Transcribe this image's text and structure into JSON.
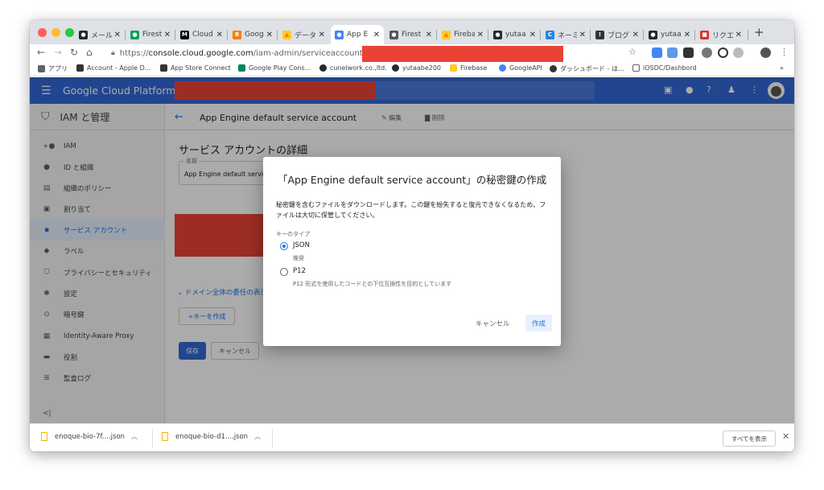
{
  "browser": {
    "tabs": [
      {
        "title": "メール",
        "favicon": "github-icon",
        "color": "#24292e",
        "glyph": "●"
      },
      {
        "title": "Firest",
        "favicon": "hangouts-icon",
        "color": "#0f9d58",
        "glyph": "●"
      },
      {
        "title": "Cloud",
        "favicon": "medium-icon",
        "color": "#000000",
        "glyph": "M"
      },
      {
        "title": "Google",
        "favicon": "blogger-icon",
        "color": "#f57d00",
        "glyph": "B"
      },
      {
        "title": "データ",
        "favicon": "firebase-icon",
        "color": "#ffca28",
        "glyph": "▲"
      },
      {
        "title": "App E",
        "favicon": "gcp-shield-icon",
        "color": "#4285f4",
        "glyph": "●"
      },
      {
        "title": "Firest",
        "favicon": "avatar-icon",
        "color": "#555555",
        "glyph": "●"
      },
      {
        "title": "Fireba",
        "favicon": "firebase-icon",
        "color": "#ffca28",
        "glyph": "▲"
      },
      {
        "title": "yutaa",
        "favicon": "github-icon",
        "color": "#24292e",
        "glyph": "●"
      },
      {
        "title": "ネーミ",
        "favicon": "cc-icon",
        "color": "#1e88e5",
        "glyph": "C"
      },
      {
        "title": "ブログ",
        "favicon": "info-icon",
        "color": "#333333",
        "glyph": "!"
      },
      {
        "title": "yutaa",
        "favicon": "github-icon",
        "color": "#24292e",
        "glyph": "●"
      },
      {
        "title": "リクエ",
        "favicon": "red-square-icon",
        "color": "#d93025",
        "glyph": "■"
      }
    ],
    "new_tab_label": "+",
    "url_prefix": "https://",
    "url_host": "console.cloud.google.com",
    "url_path": "/iam-admin/serviceaccounts/details/",
    "bookmarks": [
      {
        "label": "アプリ",
        "icon": "apps-grid-icon",
        "color": "#5f6368"
      },
      {
        "label": "Account - Apple D...",
        "icon": "apple-icon",
        "color": "#333333"
      },
      {
        "label": "App Store Connect",
        "icon": "apple-icon",
        "color": "#333333"
      },
      {
        "label": "Google Play Cons...",
        "icon": "google-play-icon",
        "color": "#01875f"
      },
      {
        "label": "cunelwork.co.,ltd.",
        "icon": "github-icon",
        "color": "#24292e"
      },
      {
        "label": "yutaabe200",
        "icon": "github-icon",
        "color": "#24292e"
      },
      {
        "label": "Firebase",
        "icon": "firebase-icon",
        "color": "#ffca28"
      },
      {
        "label": "GoogleAPI",
        "icon": "google-icon",
        "color": "#4285f4"
      },
      {
        "label": "ダッシュボード - は...",
        "icon": "info-icon",
        "color": "#333333"
      },
      {
        "label": "iOSDC/Dashbord",
        "icon": "doc-icon",
        "color": "#5f6368"
      }
    ],
    "bookmarks_more": "»"
  },
  "gcp": {
    "title": "Google Cloud Platform"
  },
  "sidebar": {
    "header": "IAM と管理",
    "items": [
      {
        "label": "IAM",
        "icon": "person-add-icon"
      },
      {
        "label": "ID と組織",
        "icon": "account-circle-icon"
      },
      {
        "label": "組織のポリシー",
        "icon": "policy-doc-icon"
      },
      {
        "label": "割り当て",
        "icon": "quota-icon"
      },
      {
        "label": "サービス アカウント",
        "icon": "service-account-icon",
        "selected": true
      },
      {
        "label": "ラベル",
        "icon": "label-icon"
      },
      {
        "label": "プライバシーとセキュリティ",
        "icon": "security-shield-icon"
      },
      {
        "label": "設定",
        "icon": "gear-icon"
      },
      {
        "label": "暗号鍵",
        "icon": "key-shield-icon"
      },
      {
        "label": "Identity-Aware Proxy",
        "icon": "iap-icon"
      },
      {
        "label": "役割",
        "icon": "roles-icon"
      },
      {
        "label": "監査ログ",
        "icon": "audit-log-icon"
      }
    ],
    "collapse_label": "<|"
  },
  "main": {
    "page_title": "App Engine default service account",
    "edit_label": "編集",
    "delete_label": "削除",
    "section_title": "サービス アカウントの詳細",
    "name_label": "名前",
    "name_value": "App Engine default service account",
    "domain_toggle": "ドメイン全体の委任の表示",
    "add_key_label": "+キーを作成",
    "save_label": "保存",
    "cancel_label": "キャンセル"
  },
  "dialog": {
    "title": "「App Engine default service account」の秘密鍵の作成",
    "description": "秘密鍵を含むファイルをダウンロードします。この鍵を紛失すると復元できなくなるため、ファイルは大切に保管してください。",
    "key_type_label": "キーのタイプ",
    "options": [
      {
        "label": "JSON",
        "sub": "推奨",
        "selected": true
      },
      {
        "label": "P12",
        "sub": "P12 形式を使用したコードとの下位互換性を目的としています",
        "selected": false
      }
    ],
    "cancel_label": "キャンセル",
    "create_label": "作成"
  },
  "downloads": {
    "items": [
      {
        "name": "enoque-bio-7f....json"
      },
      {
        "name": "enoque-bio-d1....json"
      }
    ],
    "show_all": "すべてを表示",
    "close": "✕"
  },
  "colors": {
    "gcp_blue": "#3367d6",
    "accent": "#1a73e8",
    "redaction": "#ea4335"
  }
}
